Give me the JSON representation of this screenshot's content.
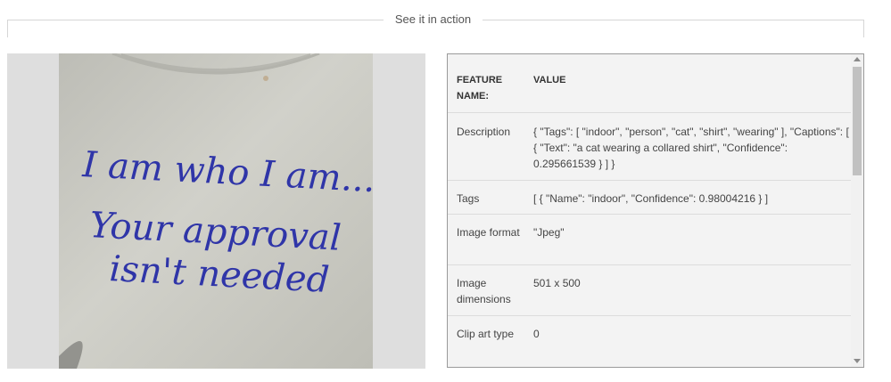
{
  "section": {
    "title": "See it in action"
  },
  "photo": {
    "shirt_text_line1": "I am who I am...",
    "shirt_text_line2": "Your approval",
    "shirt_text_line3": "isn't needed"
  },
  "table": {
    "header": {
      "name": "FEATURE NAME:",
      "value": "VALUE"
    },
    "rows": [
      {
        "name": "Description",
        "value": "{ \"Tags\": [ \"indoor\", \"person\", \"cat\", \"shirt\", \"wearing\" ], \"Captions\": [ { \"Text\": \"a cat wearing a collared shirt\", \"Confidence\": 0.295661539 } ] }"
      },
      {
        "name": "Tags",
        "value": "[ { \"Name\": \"indoor\", \"Confidence\": 0.98004216 } ]"
      },
      {
        "name": "Image format",
        "value": "\"Jpeg\""
      },
      {
        "name": "Image dimensions",
        "value": "501 x 500"
      },
      {
        "name": "Clip art type",
        "value": "0"
      }
    ]
  },
  "colors": {
    "ink": "#2f35a8",
    "shirt": "#c9c9c2",
    "panel_bg": "#dedede",
    "table_bg": "#f3f3f3"
  }
}
